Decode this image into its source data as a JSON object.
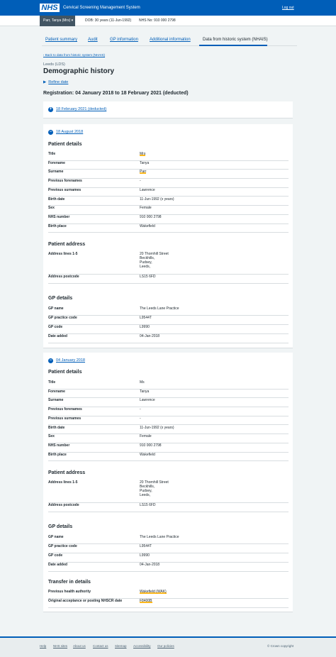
{
  "header": {
    "logo": "NHS",
    "service": "Cervical Screening Management System",
    "logout": "Log out"
  },
  "patient": {
    "name": "Parr, Tanya (Mrs)",
    "dob": "DOB: 30 years (11-Jun-1992)",
    "nhs": "NHS No: 910 000 2798"
  },
  "tabs": [
    "Patient summary",
    "Audit",
    "GP information",
    "Additional information",
    "Data from historic system (NHAIS)"
  ],
  "back": "Back to data from historic system (NHAIS)",
  "caption": "Leeds (LDS)",
  "title": "Demographic history",
  "refine": "Refine date",
  "registration": "Registration: 04 January 2018 to 18 February 2021 (deducted)",
  "collapsed": {
    "label": "18 February 2021 (deducted)",
    "icon": "plus-icon"
  },
  "record1": {
    "label": "18 August 2018",
    "patient_heading": "Patient details",
    "patient": [
      {
        "k": "Title",
        "v": "Mrs"
      },
      {
        "k": "Forename",
        "v": "Tanya"
      },
      {
        "k": "Surname",
        "v": "Parr"
      },
      {
        "k": "Previous forenames",
        "v": "-"
      },
      {
        "k": "Previous surnames",
        "v": "Lawrence"
      },
      {
        "k": "Birth date",
        "v": "11-Jun-1992 (x years)"
      },
      {
        "k": "Sex",
        "v": "Female"
      },
      {
        "k": "NHS number",
        "v": "910 000 2798"
      },
      {
        "k": "Birth place",
        "v": "Wakefield"
      }
    ],
    "address_heading": "Patient address",
    "address": [
      {
        "k": "Address lines 1-5",
        "v": "20 Thornhill Street\nBeckhills,\nPudsey,\nLeeds,"
      },
      {
        "k": "Address postcode",
        "v": "LS15 6FD"
      }
    ],
    "gp_heading": "GP details",
    "gp": [
      {
        "k": "GP name",
        "v": "The Leeds Lane Practice"
      },
      {
        "k": "GP practice code",
        "v": "L9544T"
      },
      {
        "k": "GP code",
        "v": "L9990"
      },
      {
        "k": "Date added",
        "v": "04-Jan-2018"
      }
    ]
  },
  "record2": {
    "label": "04 January 2018",
    "patient_heading": "Patient details",
    "patient": [
      {
        "k": "Title",
        "v": "Ms"
      },
      {
        "k": "Forename",
        "v": "Tanya"
      },
      {
        "k": "Surname",
        "v": "Lawrence"
      },
      {
        "k": "Previous forenames",
        "v": "-"
      },
      {
        "k": "Previous surnames",
        "v": "-"
      },
      {
        "k": "Birth date",
        "v": "11-Jun-1992 (x years)"
      },
      {
        "k": "Sex",
        "v": "Female"
      },
      {
        "k": "NHS number",
        "v": "910 000 2798"
      },
      {
        "k": "Birth place",
        "v": "Wakefield"
      }
    ],
    "address_heading": "Patient address",
    "address": [
      {
        "k": "Address lines 1-5",
        "v": "20 Thornhill Street\nBeckhills,\nPudsey,\nLeeds,"
      },
      {
        "k": "Address postcode",
        "v": "LS15 6FD"
      }
    ],
    "gp_heading": "GP details",
    "gp": [
      {
        "k": "GP name",
        "v": "The Leeds Lane Practice"
      },
      {
        "k": "GP practice code",
        "v": "L9544T"
      },
      {
        "k": "GP code",
        "v": "L9990"
      },
      {
        "k": "Date added",
        "v": "04-Jan-2018"
      }
    ],
    "transfer_heading": "Transfer in details",
    "transfer": [
      {
        "k": "Previous health authority",
        "v": "Wakefield (WAK)"
      },
      {
        "k": "Original acceptance or posting NHSCR date",
        "v": "F8400B"
      }
    ]
  },
  "footer": {
    "links": [
      "Help",
      "NHS sites",
      "About us",
      "Contact us",
      "Sitemap",
      "Accessibility",
      "Our policies"
    ],
    "copyright": "© Crown copyright"
  },
  "colors": {
    "nhs_blue": "#005eb8",
    "highlight": "#ffb81c"
  }
}
